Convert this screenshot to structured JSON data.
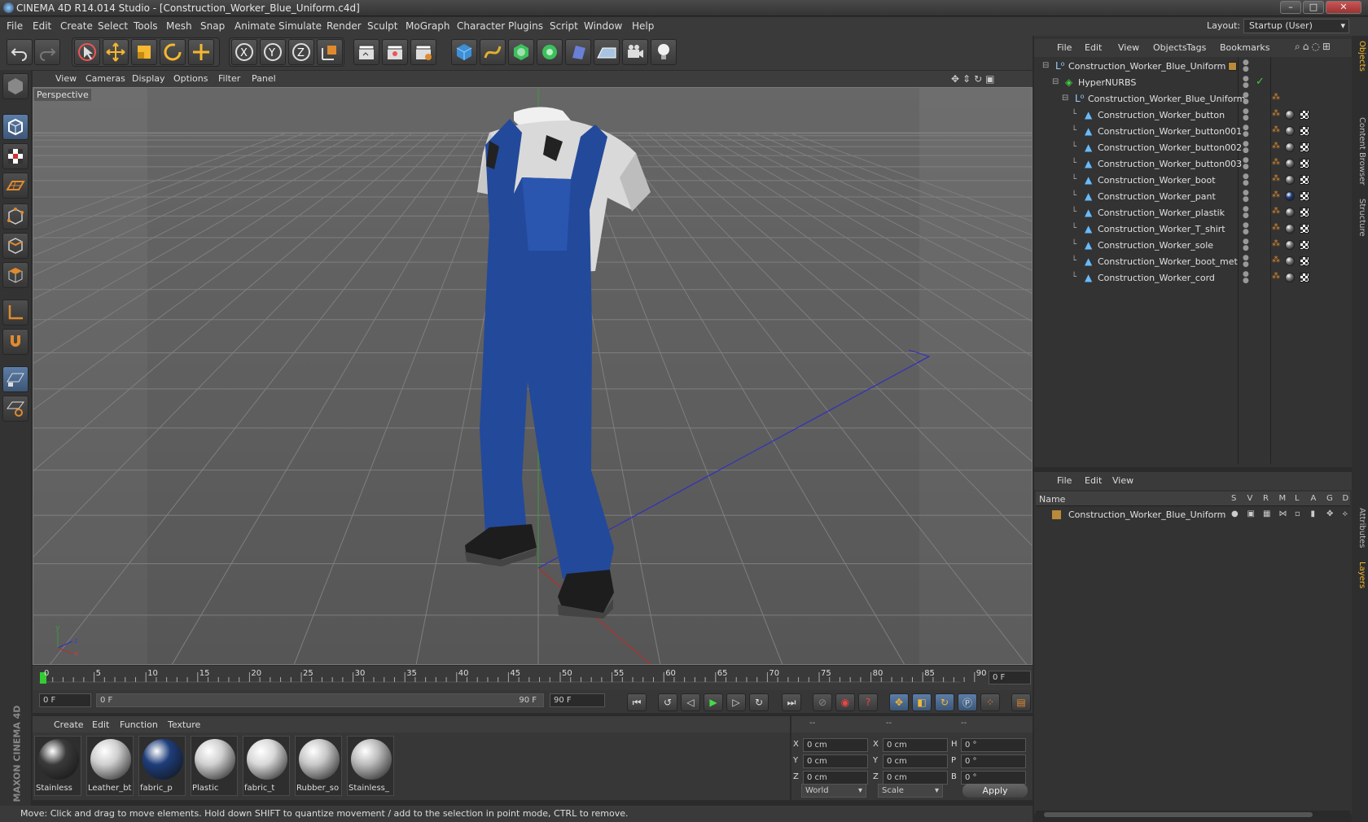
{
  "window": {
    "title": "CINEMA 4D R14.014 Studio - [Construction_Worker_Blue_Uniform.c4d]"
  },
  "menu": [
    "File",
    "Edit",
    "Create",
    "Select",
    "Tools",
    "Mesh",
    "Snap",
    "Animate",
    "Simulate",
    "Render",
    "Sculpt",
    "MoGraph",
    "Character",
    "Plugins",
    "Script",
    "Window",
    "Help"
  ],
  "layout": {
    "label": "Layout:",
    "value": "Startup (User)"
  },
  "viewport": {
    "menu": [
      "View",
      "Cameras",
      "Display",
      "Options",
      "Filter",
      "Panel"
    ],
    "label": "Perspective"
  },
  "timeline": {
    "ticks": [
      "0",
      "5",
      "10",
      "15",
      "20",
      "25",
      "30",
      "35",
      "40",
      "45",
      "50",
      "55",
      "60",
      "65",
      "70",
      "75",
      "80",
      "85",
      "90"
    ],
    "frame_display": "0 F",
    "start_field": "0 F",
    "range_start": "0 F",
    "range_end": "90 F",
    "end_field": "90 F"
  },
  "materials": {
    "menu": [
      "Create",
      "Edit",
      "Function",
      "Texture"
    ],
    "items": [
      {
        "label": "Stainless",
        "color": "#3a3a3a"
      },
      {
        "label": "Leather_bt",
        "color": "#cfcfcf"
      },
      {
        "label": "fabric_p",
        "color": "#1e3d7a"
      },
      {
        "label": "Plastic",
        "color": "#d0d0d0"
      },
      {
        "label": "fabric_t",
        "color": "#d8d8d8"
      },
      {
        "label": "Rubber_so",
        "color": "#c8c8c8"
      },
      {
        "label": "Stainless_",
        "color": "#bcbcbc"
      }
    ]
  },
  "coords": {
    "headers": [
      "--",
      "--",
      "--"
    ],
    "rows": [
      {
        "a": "X",
        "v1": "0 cm",
        "b": "X",
        "v2": "0 cm",
        "c": "H",
        "v3": "0 °"
      },
      {
        "a": "Y",
        "v1": "0 cm",
        "b": "Y",
        "v2": "0 cm",
        "c": "P",
        "v3": "0 °"
      },
      {
        "a": "Z",
        "v1": "0 cm",
        "b": "Z",
        "v2": "0 cm",
        "c": "B",
        "v3": "0 °"
      }
    ],
    "world": "World",
    "scale": "Scale",
    "apply": "Apply"
  },
  "status": "Move: Click and drag to move elements. Hold down SHIFT to quantize movement / add to the selection in point mode, CTRL to remove.",
  "objects": {
    "menu": [
      "File",
      "Edit",
      "View",
      "Objects",
      "Tags",
      "Bookmarks"
    ],
    "items": [
      {
        "name": "Construction_Worker_Blue_Uniform",
        "level": 0,
        "icon": "null"
      },
      {
        "name": "HyperNURBS",
        "level": 1,
        "icon": "nurbs"
      },
      {
        "name": "Construction_Worker_Blue_Uniform",
        "level": 2,
        "icon": "null"
      },
      {
        "name": "Construction_Worker_button",
        "level": 3,
        "icon": "poly"
      },
      {
        "name": "Construction_Worker_button001",
        "level": 3,
        "icon": "poly"
      },
      {
        "name": "Construction_Worker_button002",
        "level": 3,
        "icon": "poly"
      },
      {
        "name": "Construction_Worker_button003",
        "level": 3,
        "icon": "poly"
      },
      {
        "name": "Construction_Worker_boot",
        "level": 3,
        "icon": "poly"
      },
      {
        "name": "Construction_Worker_pant",
        "level": 3,
        "icon": "poly"
      },
      {
        "name": "Construction_Worker_plastik",
        "level": 3,
        "icon": "poly"
      },
      {
        "name": "Construction_Worker_T_shirt",
        "level": 3,
        "icon": "poly"
      },
      {
        "name": "Construction_Worker_sole",
        "level": 3,
        "icon": "poly"
      },
      {
        "name": "Construction_Worker_boot_met",
        "level": 3,
        "icon": "poly"
      },
      {
        "name": "Construction_Worker_cord",
        "level": 3,
        "icon": "poly"
      }
    ]
  },
  "layers": {
    "menu": [
      "File",
      "Edit",
      "View"
    ],
    "header": {
      "name": "Name",
      "cols": [
        "S",
        "V",
        "R",
        "M",
        "L",
        "A",
        "G",
        "D"
      ]
    },
    "items": [
      {
        "name": "Construction_Worker_Blue_Uniform"
      }
    ]
  },
  "right_tabs": [
    "Objects",
    "Content Browser",
    "Structure",
    "Attributes",
    "Layers"
  ],
  "brand": "MAXON CINEMA 4D"
}
